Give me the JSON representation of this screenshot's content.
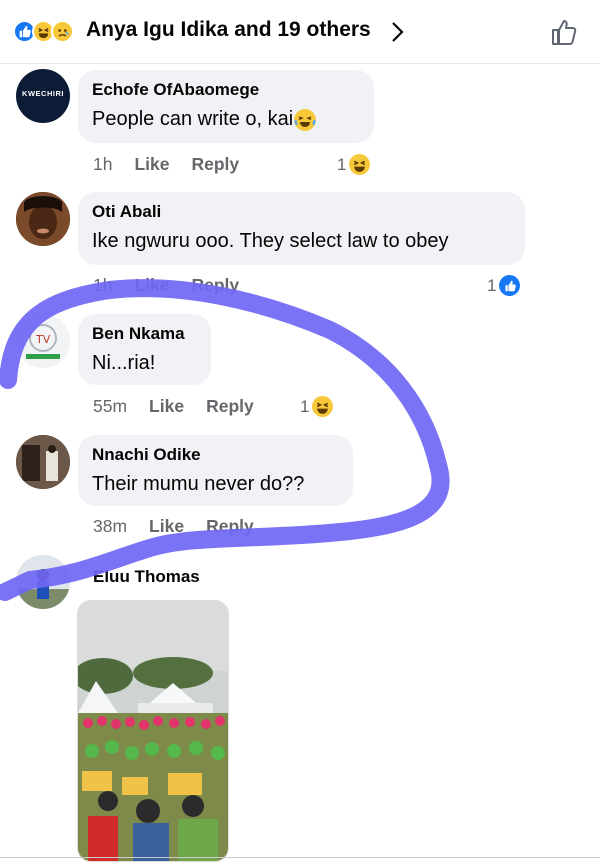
{
  "header": {
    "title": "Anya Igu Idika and 19 others",
    "reaction_icons": [
      "like-icon",
      "haha-icon",
      "sad-icon"
    ]
  },
  "comments": [
    {
      "name": "Echofe OfAbaomege",
      "text": "People can write o, kai",
      "time": "1h",
      "like": "Like",
      "reply": "Reply",
      "reaction_count": "1",
      "reaction_icon": "haha-icon",
      "avatar_label": "KWECHIRI"
    },
    {
      "name": "Oti Abali",
      "text": "Ike ngwuru ooo. They select law to obey",
      "time": "1h",
      "like": "Like",
      "reply": "Reply",
      "reaction_count": "1",
      "reaction_icon": "like-icon"
    },
    {
      "name": "Ben Nkama",
      "text": "Ni...ria!",
      "time": "55m",
      "like": "Like",
      "reply": "Reply",
      "reaction_count": "1",
      "reaction_icon": "haha-icon"
    },
    {
      "name": "Nnachi Odike",
      "text": "Their mumu never do??",
      "time": "38m",
      "like": "Like",
      "reply": "Reply"
    },
    {
      "name": "Eluu Thomas"
    }
  ],
  "colors": {
    "like_blue": "#1877f2",
    "annotation_stroke": "#6c63ff",
    "bubble_bg": "#f0f2f5"
  }
}
